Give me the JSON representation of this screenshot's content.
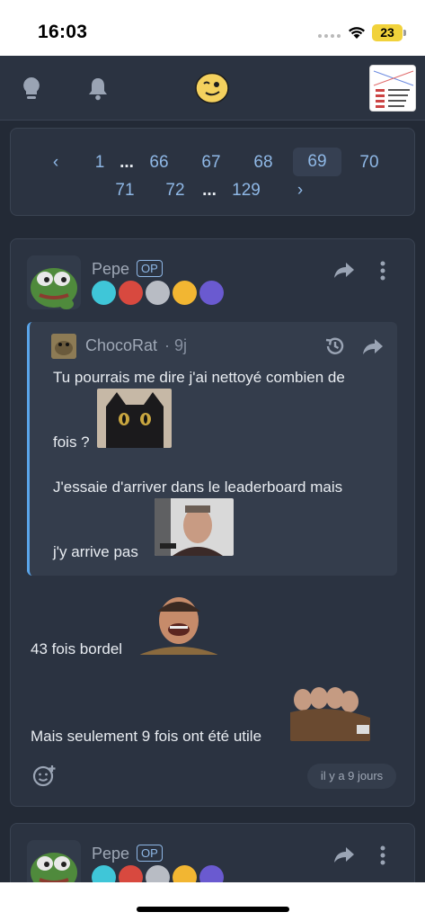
{
  "status_bar": {
    "time": "16:03",
    "battery": "23"
  },
  "top_nav": {
    "icons": [
      "lightbulb-icon",
      "bell-icon",
      "site-logo-smiley",
      "profile-thumbnail"
    ]
  },
  "pagination": {
    "prev": "‹",
    "next": "›",
    "row1": [
      "1",
      "...",
      "66",
      "67",
      "68",
      "69",
      "70"
    ],
    "row2": [
      "71",
      "72",
      "...",
      "129"
    ],
    "current": "69"
  },
  "post": {
    "author": "Pepe",
    "op_badge": "OP",
    "quote": {
      "author": "ChocoRat",
      "date": "· 9j",
      "line1": "Tu pourrais me dire j'ai nettoyé combien de",
      "line2": "fois ?",
      "line3": "J'essaie d'arriver dans le leaderboard mais",
      "line4": "j'y arrive pas"
    },
    "body_line1": "43 fois bordel",
    "body_line2": "Mais seulement 9 fois ont été utile",
    "timestamp": "il y a 9 jours"
  },
  "next_post": {
    "author": "Pepe",
    "op_badge": "OP"
  },
  "colors": {
    "background": "#232a36",
    "card": "#2b3341",
    "accent": "#8fb8e6",
    "quote_bar": "#5aa5ea"
  }
}
